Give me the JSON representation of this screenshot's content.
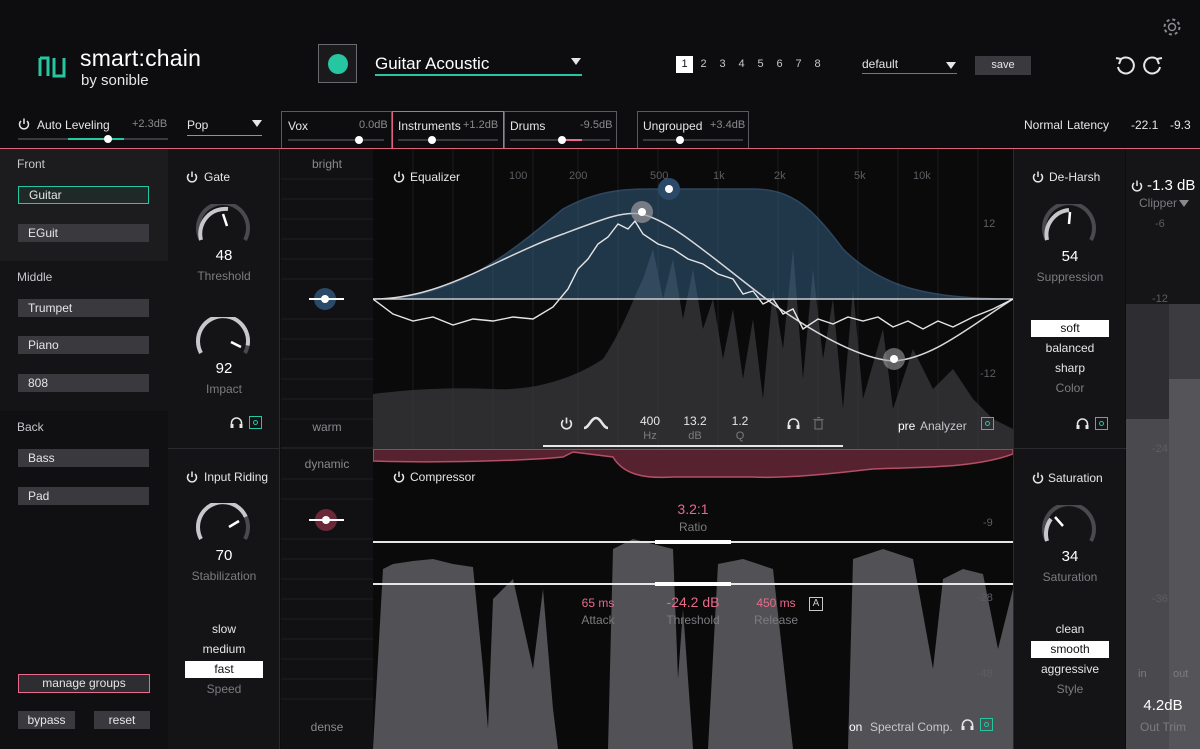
{
  "header": {
    "app_name": "smart:chain",
    "app_sub": "by sonible",
    "preset_name": "Guitar Acoustic",
    "slots": [
      "1",
      "2",
      "3",
      "4",
      "5",
      "6",
      "7",
      "8"
    ],
    "active_slot": "1",
    "profile": "default",
    "save_label": "save"
  },
  "strip": {
    "auto_leveling": "Auto Leveling",
    "auto_leveling_val": "+2.3dB",
    "genre": "Pop",
    "groups": [
      {
        "name": "Vox",
        "val": "0.0dB"
      },
      {
        "name": "Instruments",
        "val": "+1.2dB"
      },
      {
        "name": "Drums",
        "val": "-9.5dB"
      },
      {
        "name": "Ungrouped",
        "val": "+3.4dB"
      }
    ],
    "mode": "Normal",
    "latency": "Latency",
    "meter_l": "-22.1",
    "meter_r": "-9.3"
  },
  "sidebar": {
    "sections": [
      {
        "label": "Front",
        "items": [
          "Guitar",
          "EGuit"
        ]
      },
      {
        "label": "Middle",
        "items": [
          "Trumpet",
          "Piano",
          "808"
        ]
      },
      {
        "label": "Back",
        "items": [
          "Bass",
          "Pad"
        ]
      }
    ],
    "manage_groups": "manage groups",
    "bypass": "bypass",
    "reset": "reset"
  },
  "gate": {
    "title": "Gate",
    "threshold_val": "48",
    "threshold_lbl": "Threshold",
    "impact_val": "92",
    "impact_lbl": "Impact"
  },
  "input_riding": {
    "title": "Input Riding",
    "stab_val": "70",
    "stab_lbl": "Stabilization",
    "speeds": [
      "slow",
      "medium",
      "fast"
    ],
    "speed_selected": "fast",
    "speed_lbl": "Speed"
  },
  "tone": {
    "bright": "bright",
    "warm": "warm",
    "dynamic": "dynamic",
    "dense": "dense"
  },
  "equalizer": {
    "title": "Equalizer",
    "freq_labels": [
      "100",
      "200",
      "500",
      "1k",
      "2k",
      "5k",
      "10k"
    ],
    "db_labels": [
      "12",
      "-12"
    ],
    "freq_val": "400",
    "freq_unit": "Hz",
    "gain_val": "13.2",
    "gain_unit": "dB",
    "q_val": "1.2",
    "q_unit": "Q",
    "pre": "pre",
    "analyzer": "Analyzer"
  },
  "compressor": {
    "title": "Compressor",
    "ratio_val": "3.2:1",
    "ratio_lbl": "Ratio",
    "attack_val": "65 ms",
    "attack_lbl": "Attack",
    "threshold_val": "-24.2 dB",
    "threshold_lbl": "Threshold",
    "release_val": "450 ms",
    "release_lbl": "Release",
    "auto_badge": "A",
    "db_labels": [
      "-9",
      "-28",
      "-48"
    ],
    "on": "on",
    "spectral": "Spectral Comp."
  },
  "deharsh": {
    "title": "De-Harsh",
    "supp_val": "54",
    "supp_lbl": "Suppression",
    "colors": [
      "soft",
      "balanced",
      "sharp"
    ],
    "color_selected": "soft",
    "color_lbl": "Color"
  },
  "saturation": {
    "title": "Saturation",
    "sat_val": "34",
    "sat_lbl": "Saturation",
    "styles": [
      "clean",
      "smooth",
      "aggressive"
    ],
    "style_selected": "smooth",
    "style_lbl": "Style"
  },
  "output": {
    "clipper_val": "-1.3 dB",
    "clipper_lbl": "Clipper",
    "scale": [
      "-6",
      "-12",
      "-24",
      "-36"
    ],
    "in": "in",
    "out": "out",
    "trim_val": "4.2dB",
    "trim_lbl": "Out Trim"
  },
  "colors": {
    "accent": "#27c6a2",
    "pink": "#e86a8c",
    "eq_blue": "#5b8fc4"
  }
}
